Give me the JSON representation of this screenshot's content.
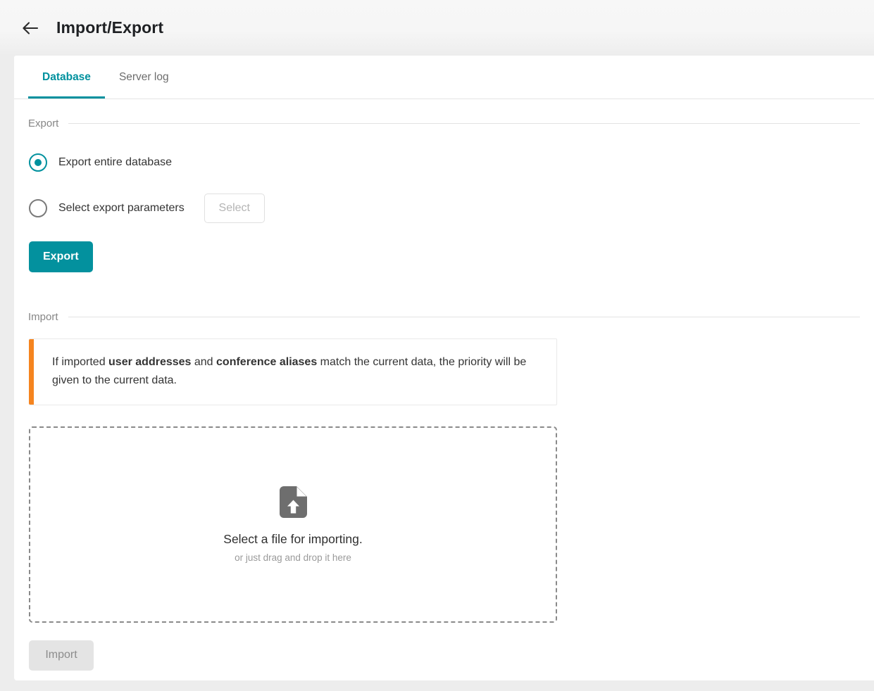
{
  "header": {
    "title": "Import/Export",
    "back_icon": "arrow-left-icon"
  },
  "tabs": [
    {
      "label": "Database",
      "active": true
    },
    {
      "label": "Server log",
      "active": false
    }
  ],
  "export_section": {
    "label": "Export",
    "options": [
      {
        "label": "Export entire database",
        "selected": true
      },
      {
        "label": "Select export parameters",
        "selected": false
      }
    ],
    "select_button": "Select",
    "export_button": "Export"
  },
  "import_section": {
    "label": "Import",
    "notice": {
      "icon": "warning-bar",
      "part1": "If imported ",
      "bold1": "user addresses",
      "part2": " and ",
      "bold2": "conference aliases",
      "part3": " match the current data, the priority will be given to the current data."
    },
    "dropzone": {
      "icon": "file-upload-icon",
      "title": "Select a file for importing.",
      "subtitle": "or just drag and drop it here"
    },
    "import_button": "Import"
  },
  "colors": {
    "accent": "#00919e",
    "notice_bar": "#f5841f",
    "header_bg": "#f6f6f6",
    "disabled_bg": "#e4e4e4"
  }
}
